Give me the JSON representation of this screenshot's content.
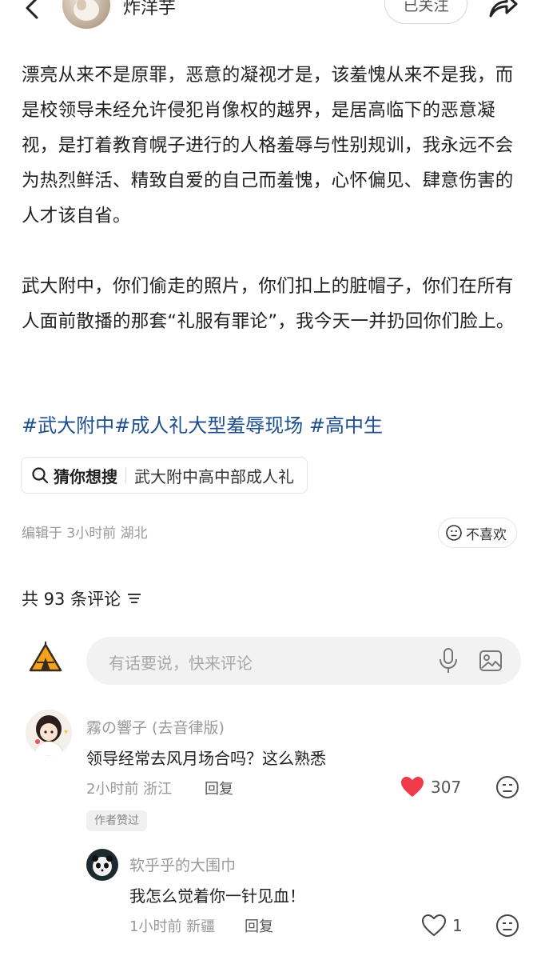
{
  "header": {
    "author_name": "炸洋芋",
    "follow_label": "已关注"
  },
  "post": {
    "paragraph1": "漂亮从来不是原罪，恶意的凝视才是，该羞愧从来不是我，而是校领导未经允许侵犯肖像权的越界，是居高临下的恶意凝视，是打着教育幌子进行的人格羞辱与性别规训，我永远不会为热烈鲜活、精致自爱的自己而羞愧，心怀偏见、肆意伤害的人才该自省。",
    "paragraph2": "武大附中，你们偷走的照片，你们扣上的脏帽子，你们在所有人面前散播的那套“礼服有罪论”，我今天一并扔回你们脸上。",
    "hashtags": [
      "#武大附中",
      "#成人礼大型羞辱现场",
      " #高中生"
    ],
    "guess_label": "猜你想搜",
    "guess_query": "武大附中高中部成人礼",
    "edited_meta": "编辑于 3小时前 湖北",
    "dislike_label": "不喜欢"
  },
  "comments_section": {
    "count_label": "共 93 条评论",
    "input_placeholder": "有话要说，快来评论"
  },
  "comments": [
    {
      "user": "霧の響子 (去音律版)",
      "text": "领导经常去风月场合吗？这么熟悉",
      "meta": "2小时前  浙江",
      "reply_label": "回复",
      "likes": "307",
      "liked": true,
      "badge": "作者赞过"
    },
    {
      "user": "软乎乎的大围巾",
      "text": "我怎么觉着你一针见血！",
      "meta": "1小时前  新疆",
      "reply_label": "回复",
      "likes": "1",
      "liked": false
    }
  ],
  "colors": {
    "hashtag": "#1d4f8e",
    "like_red": "#ee3a49",
    "muted": "#999999"
  },
  "icons": [
    "back-icon",
    "share-icon",
    "search-icon",
    "neutral-face-icon",
    "sort-icon",
    "tent-avatar-icon",
    "mic-icon",
    "image-icon",
    "heart-icon"
  ]
}
